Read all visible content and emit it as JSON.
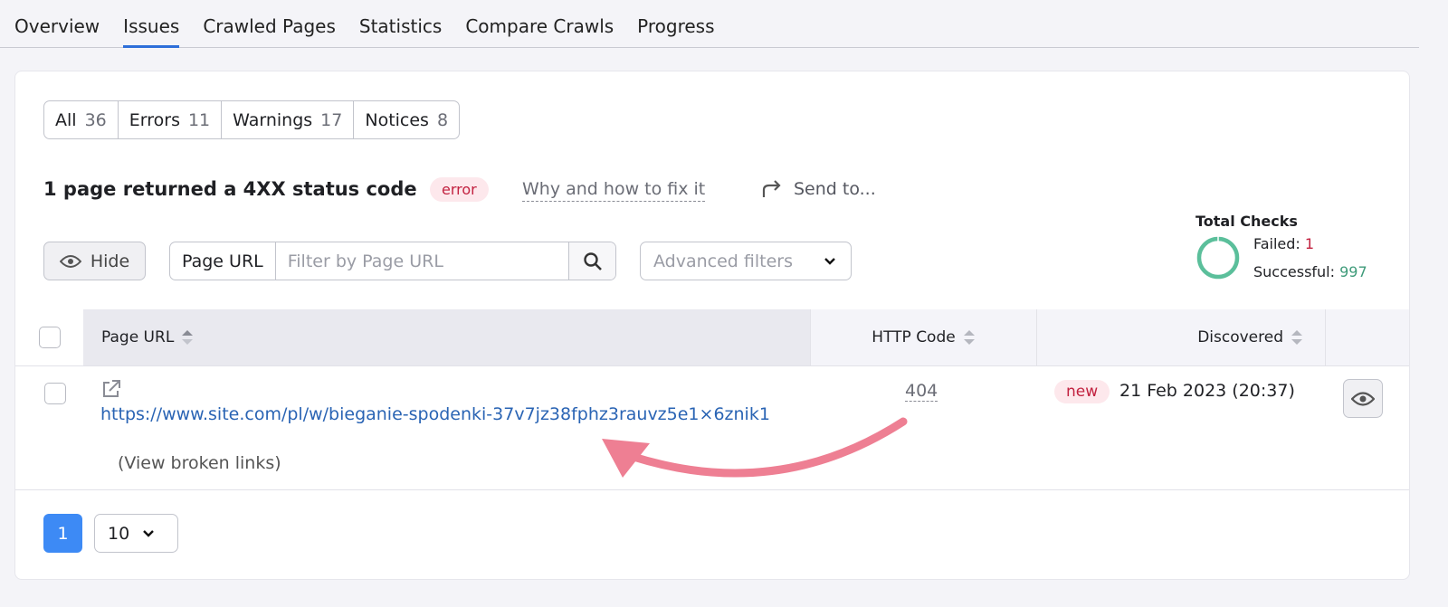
{
  "tabs": [
    {
      "label": "Overview"
    },
    {
      "label": "Issues",
      "active": true
    },
    {
      "label": "Crawled Pages"
    },
    {
      "label": "Statistics"
    },
    {
      "label": "Compare Crawls"
    },
    {
      "label": "Progress"
    }
  ],
  "segments": [
    {
      "label": "All",
      "count": "36"
    },
    {
      "label": "Errors",
      "count": "11"
    },
    {
      "label": "Warnings",
      "count": "17"
    },
    {
      "label": "Notices",
      "count": "8"
    }
  ],
  "issue": {
    "title": "1 page returned a 4XX status code",
    "badge": "error",
    "why": "Why and how to fix it",
    "send": "Send to..."
  },
  "toolbar": {
    "hide": "Hide",
    "filter_label": "Page URL",
    "filter_placeholder": "Filter by Page URL",
    "advanced": "Advanced filters"
  },
  "total_checks": {
    "title": "Total Checks",
    "failed_label": "Failed:",
    "failed": "1",
    "successful_label": "Successful:",
    "successful": "997",
    "colors": {
      "success": "#5bbf9b",
      "failed": "#c2213f"
    }
  },
  "table": {
    "columns": [
      "Page URL",
      "HTTP Code",
      "Discovered"
    ],
    "rows": [
      {
        "url": "https://www.site.com/pl/w/bieganie-spodenki-37v7jz38fphz3rauvz5e1×6znik1",
        "view_broken": "(View broken links)",
        "code": "404",
        "badge": "new",
        "discovered": "21 Feb 2023 (20:37)"
      }
    ]
  },
  "pagination": {
    "page": "1",
    "per_page": "10"
  },
  "colors": {
    "accent": "#3d8af5",
    "annotation": "#ee7f93"
  }
}
